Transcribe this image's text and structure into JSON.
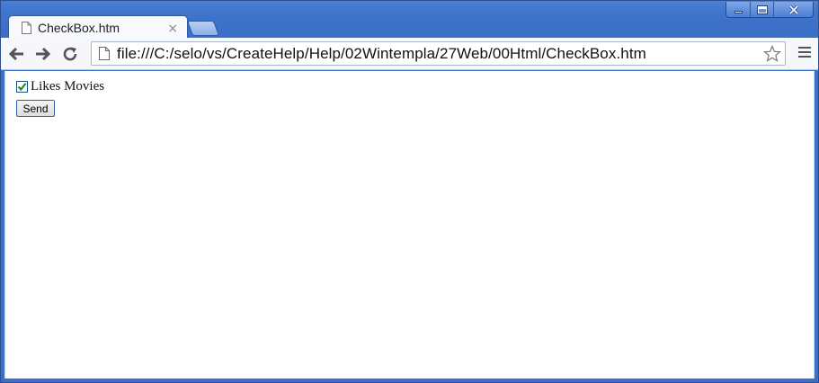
{
  "browser": {
    "tab": {
      "title": "CheckBox.htm",
      "close_glyph": "×"
    },
    "omnibox": {
      "url": "file:///C:/selo/vs/CreateHelp/Help/02Wintempla/27Web/00Html/CheckBox.htm"
    },
    "icons": {
      "back": "back-arrow-icon",
      "forward": "forward-arrow-icon",
      "reload": "reload-icon",
      "page": "page-icon",
      "star": "star-icon",
      "menu": "menu-icon"
    }
  },
  "page": {
    "checkbox": {
      "label": "Likes Movies",
      "checked": true
    },
    "send_button": {
      "label": "Send"
    }
  },
  "colors": {
    "frame": "#3f74cc",
    "check_mark": "#2a8c2a"
  }
}
